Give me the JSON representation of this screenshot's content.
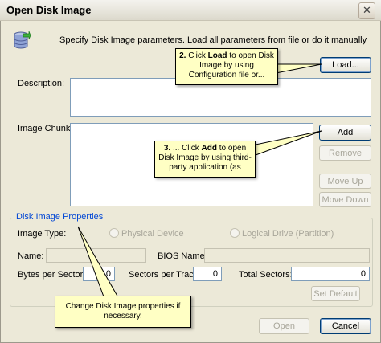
{
  "window": {
    "title": "Open Disk Image",
    "close_symbol": "✕"
  },
  "header": {
    "instructions": "Specify Disk Image parameters. Load all parameters from file or do it manually"
  },
  "buttons": {
    "load": "Load...",
    "add": "Add",
    "remove": "Remove",
    "move_up": "Move Up",
    "move_down": "Move Down",
    "set_default": "Set Default",
    "open": "Open",
    "cancel": "Cancel"
  },
  "labels": {
    "description": "Description:",
    "image_chunks": "Image Chunks:",
    "group": "Disk Image Properties",
    "image_type": "Image Type:",
    "physical_device": "Physical Device",
    "logical_drive": "Logical Drive (Partition)",
    "name": "Name:",
    "bios_name": "BIOS Name:",
    "bytes_per_sector": "Bytes per Sector:",
    "sectors_per_track": "Sectors per Track:",
    "total_sectors": "Total Sectors:"
  },
  "values": {
    "bytes_per_sector": "0",
    "sectors_per_track": "0",
    "total_sectors": "0"
  },
  "callouts": {
    "c1_num": "2.",
    "c1_pre": " Click ",
    "c1_bold": "Load",
    "c1_post": " to open Disk Image by using Configuration file or...",
    "c2_num": "3.",
    "c2_pre": " ... Click ",
    "c2_bold": "Add",
    "c2_post": " to open Disk Image by using third-party application (as",
    "c3": "Change Disk Image properties if necessary."
  },
  "colors": {
    "accent_blue": "#0046d5",
    "callout_yellow": "#ffffc4",
    "dialog_bg": "#ece9d8"
  },
  "icons": {
    "app": "database-icon",
    "close": "close-icon"
  }
}
